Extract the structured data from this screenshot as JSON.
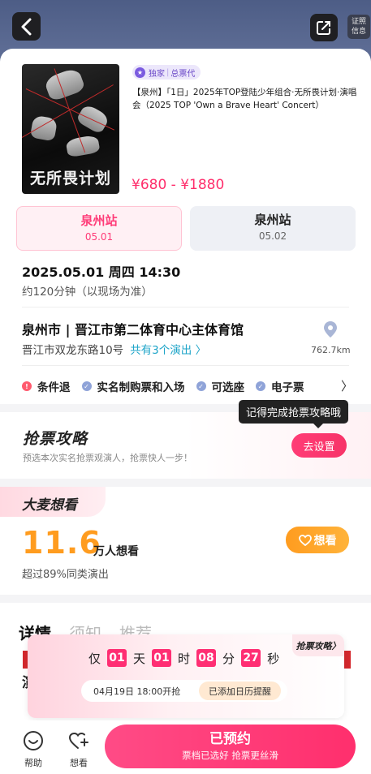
{
  "header": {
    "back_icon": "chevron-left-icon",
    "share_icon": "share-icon",
    "license_label": "证照\n信息"
  },
  "show": {
    "poster_title": "无所畏计划",
    "tag_exclusive": "独家",
    "tag_agent": "总票代",
    "title": "【泉州】「1日」2025年TOP登陆少年组合·无所畏计划·演唱会（2025 TOP 'Own a Brave Heart' Concert）",
    "price": "¥680 - ¥1880"
  },
  "stations": [
    {
      "name": "泉州站",
      "date": "05.01",
      "selected": true
    },
    {
      "name": "泉州站",
      "date": "05.02",
      "selected": false
    }
  ],
  "schedule": {
    "datetime": "2025.05.01 周四 14:30",
    "duration": "约120分钟（以现场为准）"
  },
  "venue": {
    "name": "泉州市 | 晋江市第二体育中心主体育馆",
    "address": "晋江市双龙东路10号",
    "shows": "共有3个演出 〉",
    "distance": "762.7km"
  },
  "policies": [
    "条件退",
    "实名制购票和入场",
    "可选座",
    "电子票"
  ],
  "tooltip": "记得完成抢票攻略哦",
  "strategy": {
    "title": "抢票攻略",
    "subtitle": "预选本次实名抢票观演人，抢票快人一步！",
    "button": "去设置"
  },
  "interest": {
    "title": "大麦想看",
    "count": "11.6",
    "unit": "万人想看",
    "note": "超过89%同类演出",
    "button": "想看"
  },
  "tabs": [
    "详情",
    "须知",
    "推荐"
  ],
  "detail_peek": "演",
  "countdown": {
    "badge": "抢票攻略〉",
    "prefix": "仅",
    "days": "01",
    "days_unit": "天",
    "hours": "01",
    "hours_unit": "时",
    "minutes": "08",
    "minutes_unit": "分",
    "seconds": "27",
    "seconds_unit": "秒",
    "start_time": "04月19日 18:00开抢",
    "calendar": "已添加日历提醒"
  },
  "bottom_bar": {
    "help": "帮助",
    "want": "想看",
    "book_main": "已预约",
    "book_sub": "票档已选好 抢票更丝滑"
  },
  "colors": {
    "accent": "#ff2d6b",
    "orange": "#ff9c1f",
    "link": "#1da4c8"
  }
}
